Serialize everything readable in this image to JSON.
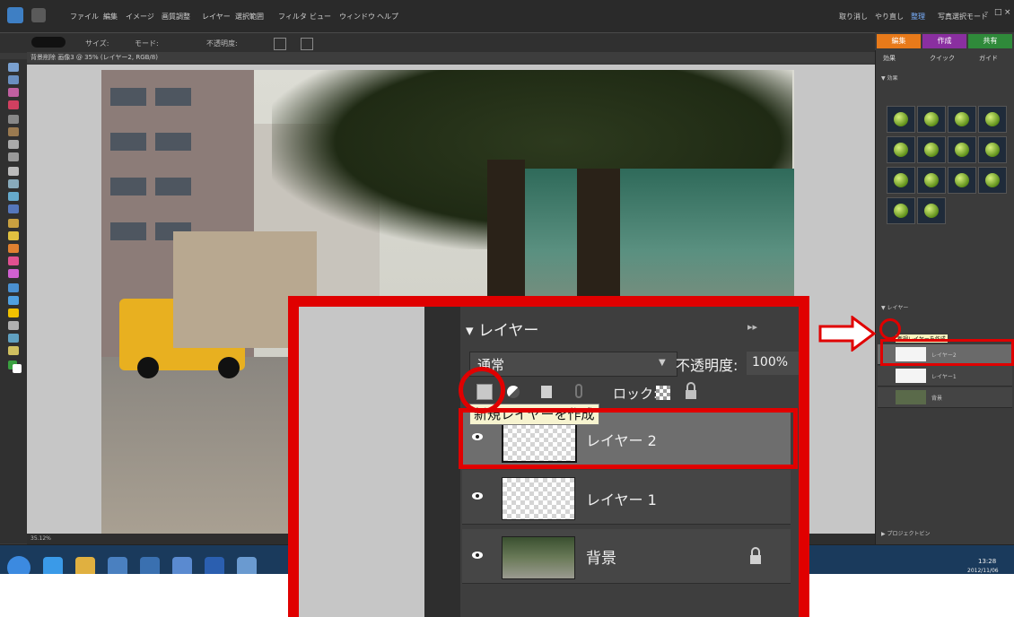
{
  "menubar": {
    "items": [
      "ファイル",
      "編集",
      "イメージ",
      "画質調整",
      "レイヤー",
      "選択範囲",
      "フィルタ",
      "ビュー",
      "ウィンドウ",
      "ヘルプ"
    ],
    "right_items": [
      "取り消し",
      "やり直し",
      "整理",
      "写真選択モード"
    ]
  },
  "options_bar": {
    "items": [
      "サイズ:",
      "モード:",
      "不透明度:"
    ]
  },
  "mode_tabs": [
    "編集",
    "作成",
    "共有"
  ],
  "document_title": "背景削除 画像3 @ 35% (レイヤー2, RGB/8)",
  "status_bar": {
    "zoom_text": "35.12%"
  },
  "right_panel": {
    "tabs": [
      "効果",
      "クイック",
      "ガイド"
    ],
    "effects_header": "▼ 効果",
    "layers_header": "▼ レイヤー",
    "mini_layers": [
      "レイヤー2",
      "レイヤー1",
      "背景"
    ],
    "tooltip": "新規レイヤーを作成",
    "bottom_text": "▶ プロジェクトビン"
  },
  "taskbar": {
    "clock_time": "13:28",
    "clock_date": "2012/11/06"
  },
  "zoom": {
    "panel_title": "レイヤー",
    "panel_collapse_icon": "▸▸",
    "blend_mode": "通常",
    "opacity_label": "不透明度:",
    "opacity_value": "100%",
    "lock_label": "ロック:",
    "tooltip": "新規レイヤーを作成",
    "layers": [
      {
        "name": "レイヤー 2",
        "selected": true
      },
      {
        "name": "レイヤー 1",
        "selected": false
      },
      {
        "name": "背景",
        "selected": false,
        "locked": true
      }
    ]
  },
  "colors": {
    "annotation_red": "#e00000",
    "panel_dark": "#3e3e3e",
    "canvas_bg": "#c6c6c6"
  }
}
